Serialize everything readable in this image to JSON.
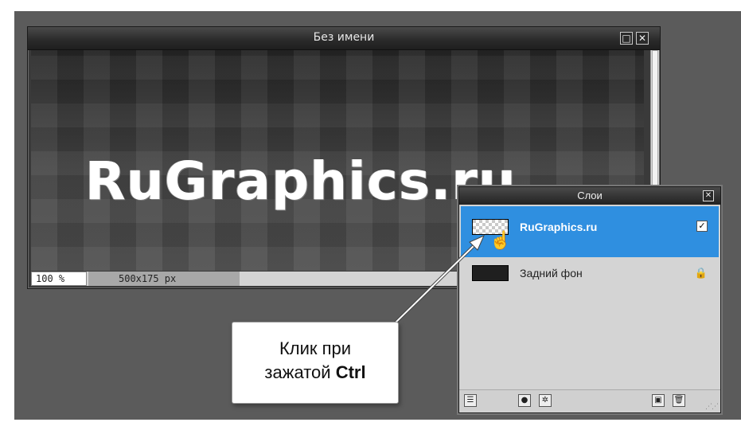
{
  "document": {
    "title": "Без имени",
    "canvas_text": "RuGraphics.ru",
    "zoom": "100 %",
    "dimensions": "500x175 px"
  },
  "layers_panel": {
    "title": "Слои",
    "layers": [
      {
        "name": "RuGraphics.ru",
        "selected": true,
        "visible": true
      },
      {
        "name": "Задний фон",
        "locked": true
      }
    ]
  },
  "callout": {
    "line1": "Клик при",
    "line2_prefix": "зажатой ",
    "line2_bold": "Ctrl"
  },
  "colors": {
    "selection": "#2f8fe0",
    "workspace": "#5b5b5b"
  }
}
